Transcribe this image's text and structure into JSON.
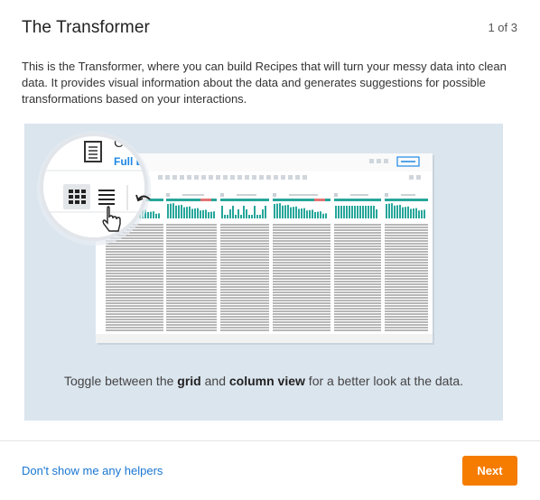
{
  "dialog": {
    "title": "The Transformer",
    "step": "1 of 3",
    "description": "This is the Transformer, where you can build Recipes that will turn your messy data into clean data. It provides visual information about the data and generates suggestions for possible transformations based on your interactions.",
    "illustration": {
      "zoom_title_partial": "Cu",
      "zoom_link_partial": "Full Da",
      "caption_pre": "Toggle between the ",
      "caption_bold1": "grid",
      "caption_mid": " and ",
      "caption_bold2": "column view",
      "caption_post": " for a better look at the data."
    },
    "footer": {
      "dismiss_link": "Don't show me any helpers",
      "next_label": "Next"
    }
  },
  "colors": {
    "accent": "#f57c00",
    "link": "#1976d2",
    "teal": "#26a69a",
    "panel": "#dbe5ee"
  },
  "icons": [
    "document-icon",
    "grid-view-icon",
    "list-view-icon",
    "undo-icon",
    "hand-cursor-icon"
  ]
}
